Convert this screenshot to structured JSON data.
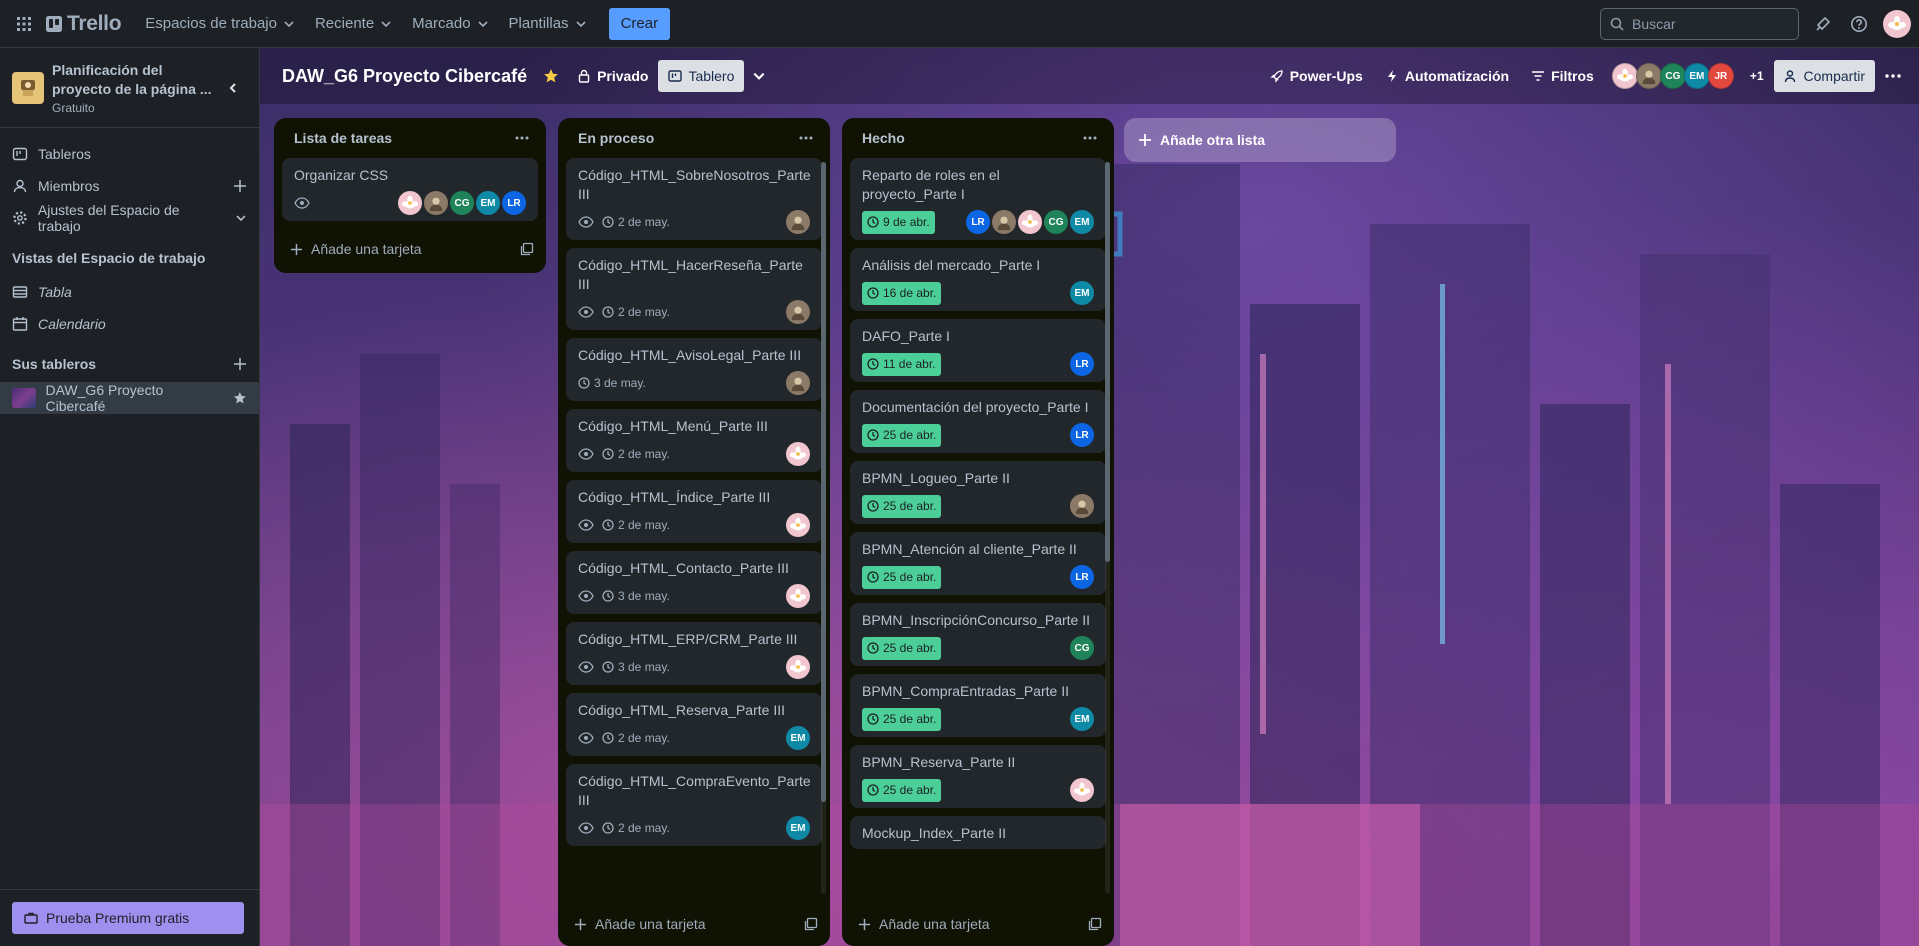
{
  "topnav": {
    "logo": "Trello",
    "menus": [
      "Espacios de trabajo",
      "Reciente",
      "Marcado",
      "Plantillas"
    ],
    "create": "Crear",
    "search_placeholder": "Buscar"
  },
  "sidebar": {
    "workspace_name": "Planificación del proyecto de la página ...",
    "workspace_plan": "Gratuito",
    "items": [
      "Tableros",
      "Miembros",
      "Ajustes del Espacio de trabajo"
    ],
    "views_heading": "Vistas del Espacio de trabajo",
    "views": [
      "Tabla",
      "Calendario"
    ],
    "boards_heading": "Sus tableros",
    "board": "DAW_G6 Proyecto Cibercafé",
    "premium": "Prueba Premium gratis"
  },
  "board": {
    "title": "DAW_G6 Proyecto Cibercafé",
    "visibility": "Privado",
    "view": "Tablero",
    "powerups": "Power-Ups",
    "automation": "Automatización",
    "filters": "Filtros",
    "members_more": "+1",
    "share": "Compartir",
    "add_list": "Añade otra lista",
    "add_card": "Añade una tarjeta"
  },
  "member_colors": {
    "LR": "#0c66e4",
    "CG": "#1f845a",
    "EM": "#0e8aa7",
    "JR": "#e2483d",
    "photo": "#8b7a68",
    "flower": "#f1c6cf"
  },
  "lists": [
    {
      "title": "Lista de tareas",
      "cards": [
        {
          "title": "Organizar CSS",
          "watch": true,
          "due": "",
          "members": [
            "flower",
            "photo",
            "CG",
            "EM",
            "LR"
          ]
        }
      ]
    },
    {
      "title": "En proceso",
      "cards": [
        {
          "title": "Código_HTML_SobreNosotros_Parte III",
          "watch": true,
          "due": "2 de may.",
          "members": [
            "photo"
          ]
        },
        {
          "title": "Código_HTML_HacerReseña_Parte III",
          "watch": true,
          "due": "2 de may.",
          "members": [
            "photo"
          ]
        },
        {
          "title": "Código_HTML_AvisoLegal_Parte III",
          "watch": false,
          "due": "3 de may.",
          "members": [
            "photo"
          ]
        },
        {
          "title": "Código_HTML_Menú_Parte III",
          "watch": true,
          "due": "2 de may.",
          "members": [
            "flower"
          ]
        },
        {
          "title": "Código_HTML_Índice_Parte III",
          "watch": true,
          "due": "2 de may.",
          "members": [
            "flower"
          ]
        },
        {
          "title": "Código_HTML_Contacto_Parte III",
          "watch": true,
          "due": "3 de may.",
          "members": [
            "flower"
          ]
        },
        {
          "title": "Código_HTML_ERP/CRM_Parte III",
          "watch": true,
          "due": "3 de may.",
          "members": [
            "flower"
          ]
        },
        {
          "title": "Código_HTML_Reserva_Parte III",
          "watch": true,
          "due": "2 de may.",
          "members": [
            "EM"
          ]
        },
        {
          "title": "Código_HTML_CompraEvento_Parte III",
          "watch": true,
          "due": "2 de may.",
          "members": [
            "EM"
          ]
        }
      ]
    },
    {
      "title": "Hecho",
      "cards": [
        {
          "title": "Reparto de roles en el proyecto_Parte I",
          "watch": false,
          "due": "9 de abr.",
          "done": true,
          "members": [
            "LR",
            "photo",
            "flower",
            "CG",
            "EM"
          ]
        },
        {
          "title": "Análisis del mercado_Parte I",
          "watch": false,
          "due": "16 de abr.",
          "done": true,
          "members": [
            "EM"
          ]
        },
        {
          "title": "DAFO_Parte I",
          "watch": false,
          "due": "11 de abr.",
          "done": true,
          "members": [
            "LR"
          ]
        },
        {
          "title": "Documentación del proyecto_Parte I",
          "watch": false,
          "due": "25 de abr.",
          "done": true,
          "members": [
            "LR"
          ]
        },
        {
          "title": "BPMN_Logueo_Parte II",
          "watch": false,
          "due": "25 de abr.",
          "done": true,
          "members": [
            "photo"
          ]
        },
        {
          "title": "BPMN_Atención al cliente_Parte II",
          "watch": false,
          "due": "25 de abr.",
          "done": true,
          "members": [
            "LR"
          ]
        },
        {
          "title": "BPMN_InscripciónConcurso_Parte II",
          "watch": false,
          "due": "25 de abr.",
          "done": true,
          "members": [
            "CG"
          ]
        },
        {
          "title": "BPMN_CompraEntradas_Parte II",
          "watch": false,
          "due": "25 de abr.",
          "done": true,
          "members": [
            "EM"
          ]
        },
        {
          "title": "BPMN_Reserva_Parte II",
          "watch": false,
          "due": "25 de abr.",
          "done": true,
          "members": [
            "flower"
          ]
        },
        {
          "title": "Mockup_Index_Parte II",
          "watch": false,
          "due": "",
          "done": true,
          "members": []
        }
      ]
    }
  ]
}
